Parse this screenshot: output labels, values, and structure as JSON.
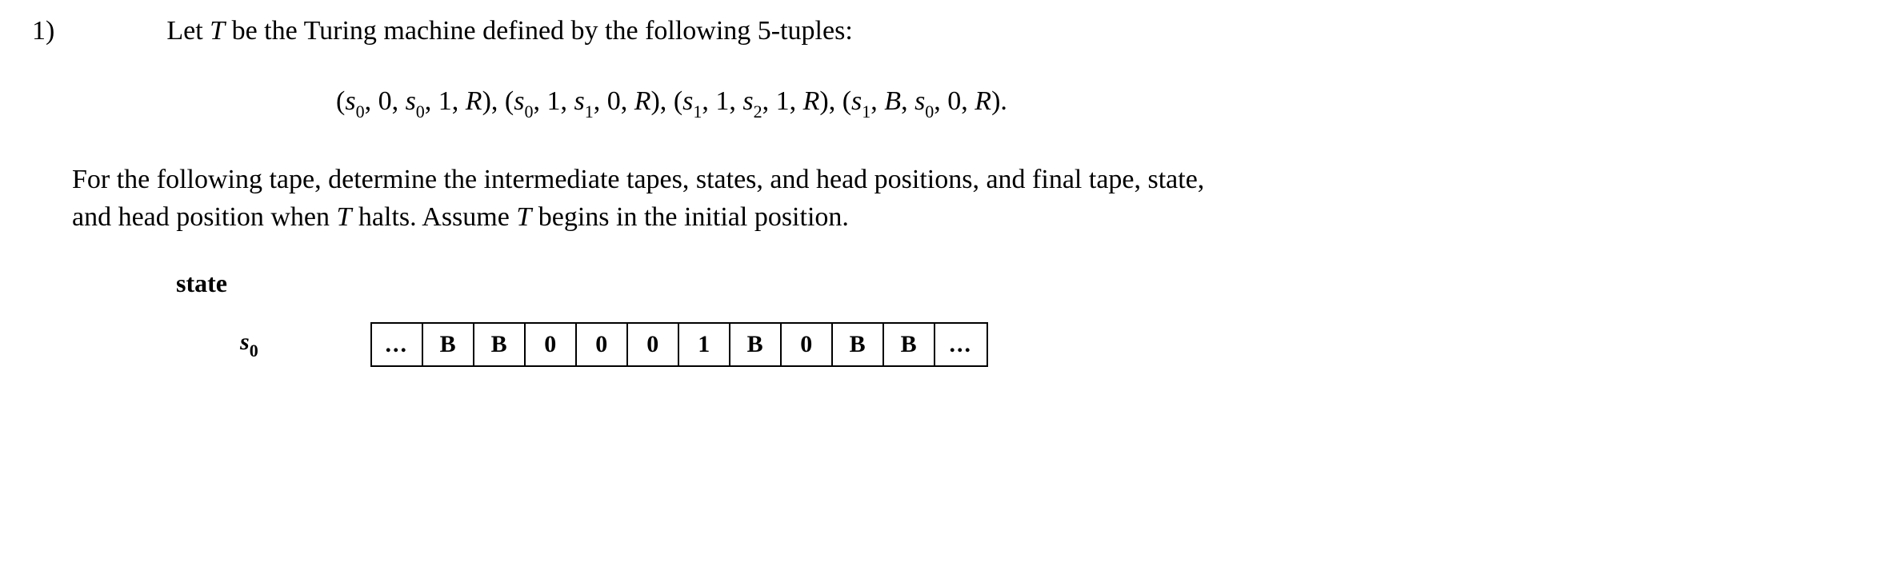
{
  "problem": {
    "number": "1)",
    "intro_prefix": "Let ",
    "intro_var": "T",
    "intro_suffix": " be the Turing machine defined by the following 5-tuples:"
  },
  "tuples": {
    "open1": "(",
    "s": "s",
    "sub0": "0",
    "sub1": "1",
    "sub2": "2",
    "comma": ", ",
    "zero": "0",
    "one": "1",
    "R": "R",
    "B": "B",
    "close_comma": "), ",
    "close_period": ")."
  },
  "body": {
    "line1": "For the following tape, determine the intermediate tapes, states, and head positions, and final tape, state,",
    "line2_prefix": "and head position when ",
    "line2_var": "T",
    "line2_mid": " halts. Assume ",
    "line2_var2": "T",
    "line2_suffix": " begins in the initial position."
  },
  "state_label": "state",
  "state_name_s": "s",
  "state_name_sub": "0",
  "tape_cells": [
    "...",
    "B",
    "B",
    "0",
    "0",
    "0",
    "1",
    "B",
    "0",
    "B",
    "B",
    "..."
  ]
}
